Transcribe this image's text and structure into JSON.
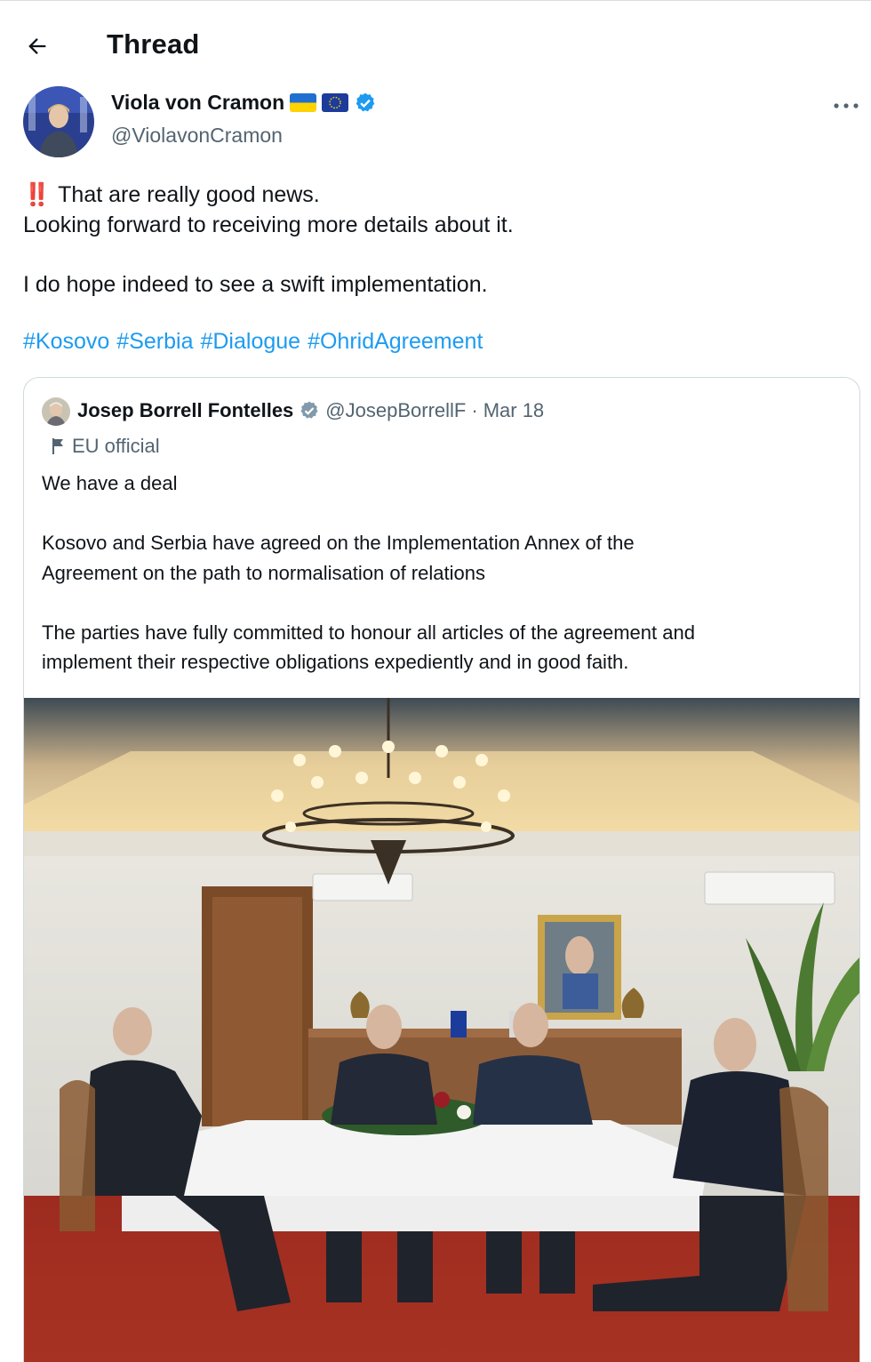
{
  "header": {
    "title": "Thread",
    "back_icon": "arrow-left-icon"
  },
  "author": {
    "name": "Viola von Cramon",
    "handle": "@ViolavonCramon",
    "flags": [
      "ukraine-flag-icon",
      "eu-flag-icon"
    ],
    "verified_icon": "verified-badge-icon",
    "more_icon": "more-horizontal-icon"
  },
  "tweet": {
    "emoji": "‼️",
    "lines": [
      "That are really good news.",
      "Looking forward to receiving more details about it.",
      "",
      "I do hope indeed to see a swift implementation."
    ],
    "hashtags": [
      "#Kosovo",
      "#Serbia",
      "#Dialogue",
      "#OhridAgreement"
    ]
  },
  "quote": {
    "name": "Josep Borrell Fontelles",
    "handle": "@JosepBorrellF",
    "separator": "·",
    "date": "Mar 18",
    "badge": "EU official",
    "paragraphs": [
      "We have a deal",
      "",
      "Kosovo and Serbia have agreed on the Implementation Annex of the",
      "Agreement on the path to normalisation of relations",
      "",
      "The parties have fully committed to honour all articles of the agreement and",
      "implement their respective obligations expediently and in good faith."
    ]
  },
  "colors": {
    "link": "#1d9bf0",
    "muted": "#536471",
    "text": "#0f1419",
    "border": "#cfd9de"
  }
}
